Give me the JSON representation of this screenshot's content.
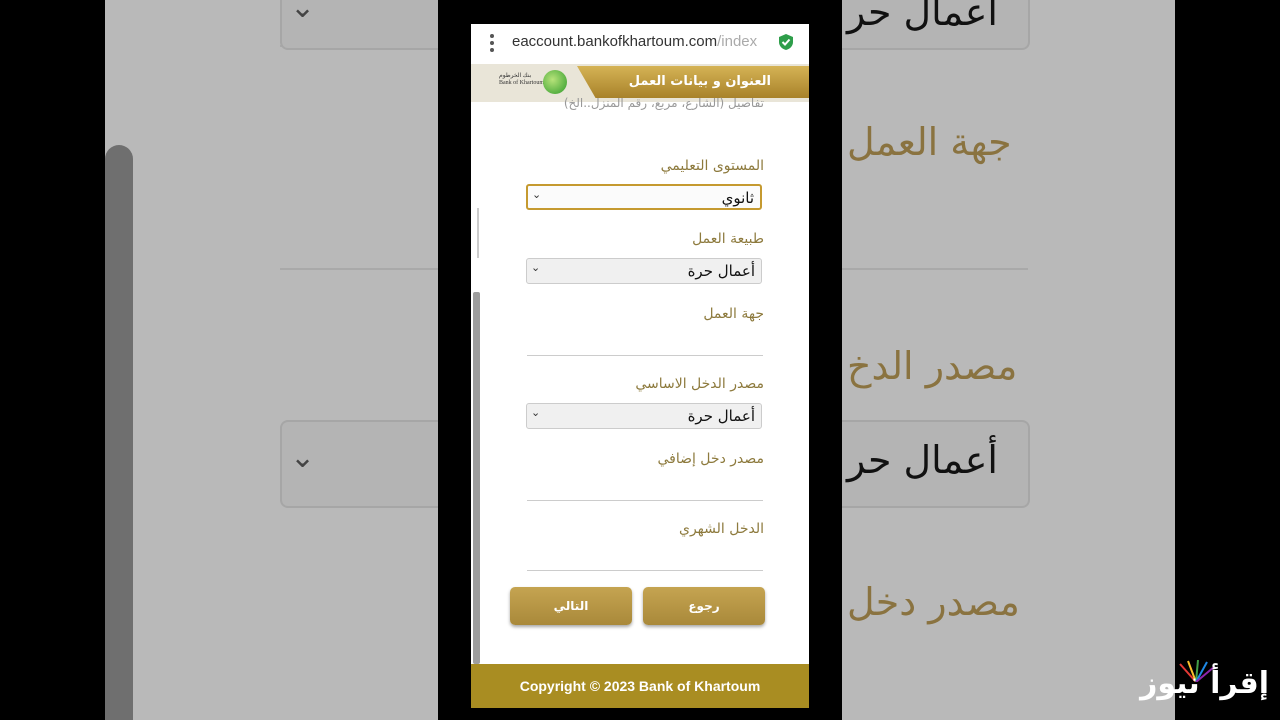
{
  "browser": {
    "url_main": "eaccount.bankofkhartoum.com",
    "url_rest": "/index"
  },
  "header": {
    "title": "العنوان و بيانات العمل",
    "logo_text_ar": "بنك الخرطوم",
    "logo_text_en": "Bank of Khartoum"
  },
  "form": {
    "cut_text": "تفاصيل (الشارع، مربع، رقم المنزل..الخ)",
    "education": {
      "label": "المستوى التعليمي",
      "value": "ثانوي"
    },
    "work_nature": {
      "label": "طبيعة العمل",
      "value": "أعمال حرة"
    },
    "employer": {
      "label": "جهة العمل",
      "value": ""
    },
    "income_source": {
      "label": "مصدر الدخل الاساسي",
      "value": "أعمال حرة"
    },
    "extra_income": {
      "label": "مصدر دخل إضافي",
      "value": ""
    },
    "monthly_income": {
      "label": "الدخل الشهري",
      "value": ""
    },
    "back_button": "رجوع",
    "next_button": "التالي"
  },
  "footer": {
    "text": "Copyright © 2023 Bank of Khartoum"
  },
  "background": {
    "ghost_1": "أعمال حر",
    "ghost_2": "جهة العمل",
    "ghost_3": "مصدر الدخ",
    "ghost_4": "أعمال حر",
    "ghost_5": "مصدر دخل"
  },
  "watermark": {
    "text": "إقرأ نيوز"
  },
  "colors": {
    "accent": "#a98d22",
    "label": "#8d7a3d",
    "shield": "#2e9e4a"
  }
}
